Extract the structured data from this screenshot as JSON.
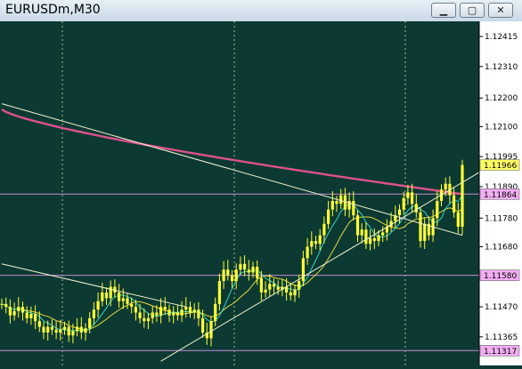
{
  "window": {
    "title": "EURUSDm,M30",
    "buttons": {
      "minimize": "▁",
      "maximize": "▢",
      "close": "✕"
    }
  },
  "colors": {
    "background": "#0c3a33",
    "candle": "#ffff33",
    "grid": "#9dbf7a",
    "scale_bg": "#ffffff",
    "hline": "#c58bd4",
    "ma_slow": "#e0508f",
    "ma_mid": "#e8d63a",
    "ma_fast": "#33d4c8",
    "trendline": "#f2f2cc"
  },
  "chart_data": {
    "type": "candlestick",
    "symbol": "EURUSDm",
    "timeframe": "M30",
    "ylim": [
      1.11265,
      1.12468
    ],
    "price_axis_labels": [
      "1.12415",
      "1.12310",
      "1.12200",
      "1.12100",
      "1.11995",
      "1.11890",
      "1.11780",
      "1.11680",
      "1.11470",
      "1.11365"
    ],
    "price_axis_label_values": [
      1.12415,
      1.1231,
      1.122,
      1.121,
      1.11995,
      1.1189,
      1.1178,
      1.1168,
      1.1147,
      1.11365
    ],
    "highlighted_prices": [
      {
        "label": "1.11966",
        "value": 1.11966,
        "style": "current"
      },
      {
        "label": "1.11864",
        "value": 1.11864,
        "style": "level"
      },
      {
        "label": "1.11580",
        "value": 1.1158,
        "style": "level"
      },
      {
        "label": "1.11317",
        "value": 1.11317,
        "style": "level"
      }
    ],
    "horizontal_levels": [
      1.11864,
      1.1158,
      1.11317
    ],
    "bar_count": 112,
    "close_series": [
      1.1148,
      1.1147,
      1.1144,
      1.11455,
      1.1147,
      1.1145,
      1.1143,
      1.11445,
      1.1142,
      1.114,
      1.1138,
      1.114,
      1.1139,
      1.1138,
      1.1139,
      1.114,
      1.1137,
      1.11385,
      1.114,
      1.1138,
      1.11395,
      1.1143,
      1.1146,
      1.1149,
      1.1152,
      1.115,
      1.1154,
      1.1152,
      1.1149,
      1.115,
      1.1148,
      1.1147,
      1.1145,
      1.1143,
      1.1142,
      1.1143,
      1.1145,
      1.1144,
      1.1147,
      1.1146,
      1.1144,
      1.1145,
      1.1144,
      1.1146,
      1.1147,
      1.1145,
      1.1146,
      1.1143,
      1.1138,
      1.1136,
      1.1142,
      1.1148,
      1.1156,
      1.116,
      1.1158,
      1.1156,
      1.116,
      1.1162,
      1.116,
      1.1159,
      1.1161,
      1.1157,
      1.1152,
      1.1153,
      1.1155,
      1.1154,
      1.1153,
      1.1154,
      1.1152,
      1.1151,
      1.1153,
      1.1156,
      1.1164,
      1.1168,
      1.117,
      1.1169,
      1.1172,
      1.1176,
      1.1181,
      1.1184,
      1.1183,
      1.1186,
      1.1181,
      1.1184,
      1.1179,
      1.1172,
      1.1174,
      1.1169,
      1.1171,
      1.117,
      1.1172,
      1.1173,
      1.1175,
      1.1177,
      1.1179,
      1.1181,
      1.1185,
      1.1187,
      1.1183,
      1.118,
      1.117,
      1.1176,
      1.1172,
      1.1178,
      1.1184,
      1.1188,
      1.119,
      1.1186,
      1.118,
      1.1175,
      1.11966
    ],
    "trendlines": [
      {
        "from": [
          0,
          1.1218
        ],
        "to": [
          110,
          1.1172
        ]
      },
      {
        "from": [
          0,
          1.1162
        ],
        "to": [
          44,
          1.1147
        ]
      },
      {
        "from": [
          38,
          1.1128
        ],
        "to": [
          117,
          1.1194
        ]
      }
    ],
    "moving_averages": [
      "slow",
      "mid",
      "fast"
    ],
    "grid": true
  }
}
